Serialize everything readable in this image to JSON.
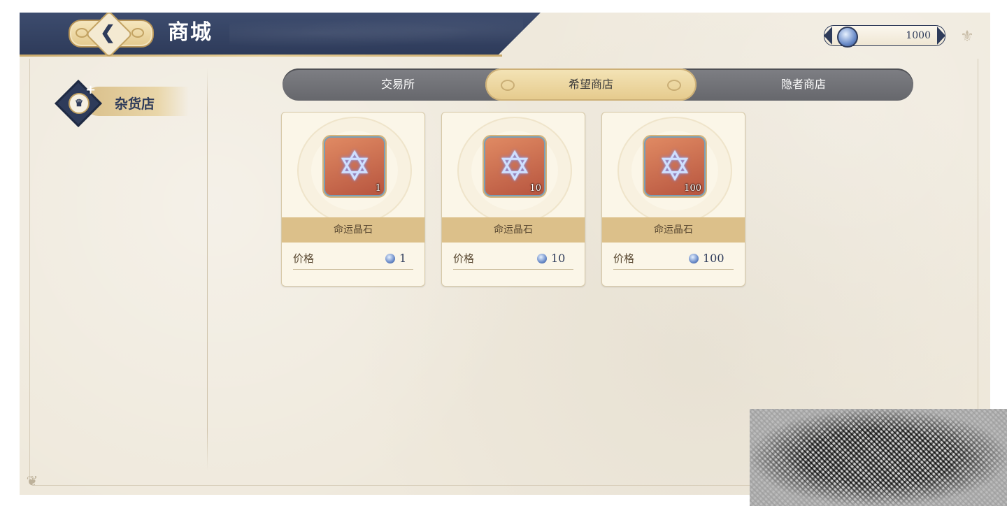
{
  "header": {
    "title": "商城",
    "back_icon": "back-arrow-icon"
  },
  "currency": {
    "icon": "crystal-coin-icon",
    "amount": "1000"
  },
  "sidebar": {
    "items": [
      {
        "label": "杂货店",
        "icon": "shop-badge-icon",
        "active": true
      }
    ]
  },
  "tabs": [
    {
      "label": "交易所",
      "active": false
    },
    {
      "label": "希望商店",
      "active": true
    },
    {
      "label": "隐者商店",
      "active": false
    }
  ],
  "products": [
    {
      "name": "命运晶石",
      "quantity": "1",
      "price_label": "价格",
      "price": "1"
    },
    {
      "name": "命运晶石",
      "quantity": "10",
      "price_label": "价格",
      "price": "10"
    },
    {
      "name": "命运晶石",
      "quantity": "100",
      "price_label": "价格",
      "price": "100"
    }
  ],
  "colors": {
    "navy": "#2e3b5a",
    "gold": "#dcc08a",
    "parchment": "#efe9dc"
  }
}
